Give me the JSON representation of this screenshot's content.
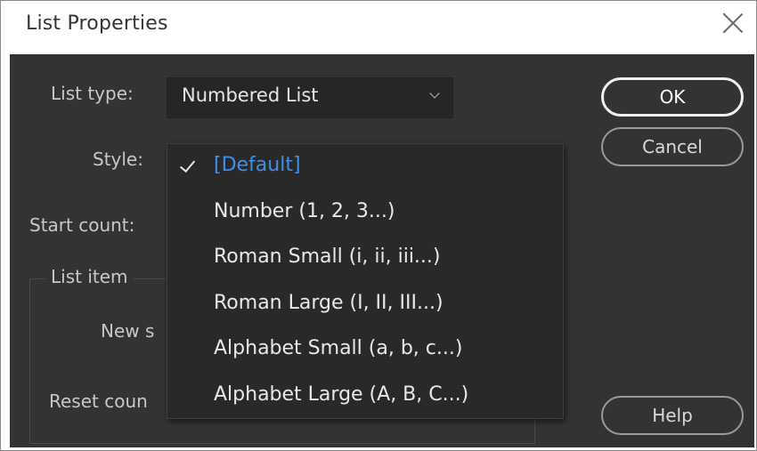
{
  "dialog": {
    "title": "List Properties"
  },
  "fields": {
    "list_type_label": "List type:",
    "list_type_value": "Numbered List",
    "style_label": "Style:",
    "start_count_label": "Start count:",
    "list_item_label": "List item",
    "new_style_label": "New s",
    "reset_count_label": "Reset coun"
  },
  "buttons": {
    "ok": "OK",
    "cancel": "Cancel",
    "help": "Help"
  },
  "style_dropdown": {
    "selected": "[Default]",
    "options": [
      "[Default]",
      "Number (1, 2, 3...)",
      "Roman Small (i, ii, iii...)",
      "Roman Large (I, II, III...)",
      "Alphabet Small (a, b, c...)",
      "Alphabet Large (A, B, C...)"
    ]
  },
  "colors": {
    "panel_bg": "#333333",
    "selected_option": "#3f8fe6"
  }
}
